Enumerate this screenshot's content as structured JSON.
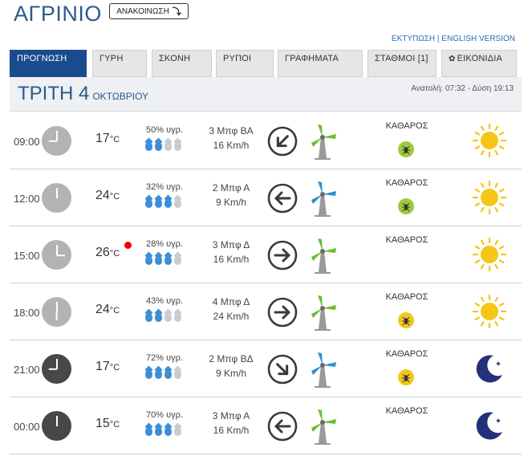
{
  "header": {
    "city": "ΑΓΡΙΝΙΟ",
    "announce_label": "ΑΝΑΚΟΙΝΩΣΗ",
    "announce_arrow": "⤵",
    "print_link": "ΕΚΤΥΠΩΣΗ",
    "sep": "|",
    "english_link": "ENGLISH VERSION"
  },
  "tabs": [
    {
      "label": "ΠΡΟΓΝΩΣΗ",
      "active": true
    },
    {
      "label": "ΓΥΡΗ"
    },
    {
      "label": "ΣΚΟΝΗ"
    },
    {
      "label": "ΡΥΠΟΙ"
    },
    {
      "label": "ΓΡΑΦΗΜΑΤΑ"
    },
    {
      "label": "ΣΤΑΘΜΟΙ [1]"
    },
    {
      "label": "ΕΙΚΟΝΙΔΙΑ",
      "icon": "gear-icon"
    }
  ],
  "day": {
    "name": "ΤΡΙΤΗ 4",
    "month": "ΟΚΤΩΒΡΙΟΥ",
    "sun": "Ανατολή: 07:32 - Δύση 19:13"
  },
  "unit": "°C",
  "rows": [
    {
      "time": "09:00",
      "hour": 9,
      "night": false,
      "temp": "17",
      "hum": "50% υγρ.",
      "drops": 2,
      "beaufort": "3 Μπφ ΒΑ",
      "kmh": "16 Km/h",
      "arrow_deg": 45,
      "turbine_color": "#6cbf2e",
      "turbine_icon": "wind-turbine-icon",
      "cond": "ΚΑΘΑΡΟΣ",
      "mosquito": "green",
      "weather_icon": "sun-icon",
      "reddot": false
    },
    {
      "time": "12:00",
      "hour": 12,
      "night": false,
      "temp": "24",
      "hum": "32% υγρ.",
      "drops": 3,
      "beaufort": "2 Μπφ Α",
      "kmh": "9 Km/h",
      "arrow_deg": 90,
      "turbine_color": "#2f8fd0",
      "turbine_icon": "wind-turbine-icon",
      "cond": "ΚΑΘΑΡΟΣ",
      "mosquito": "green",
      "weather_icon": "sun-icon",
      "reddot": false
    },
    {
      "time": "15:00",
      "hour": 15,
      "night": false,
      "temp": "26",
      "hum": "28% υγρ.",
      "drops": 3,
      "beaufort": "3 Μπφ Δ",
      "kmh": "16 Km/h",
      "arrow_deg": 270,
      "turbine_color": "#6cbf2e",
      "turbine_icon": "wind-turbine-icon",
      "cond": "ΚΑΘΑΡΟΣ",
      "mosquito": null,
      "weather_icon": "sun-icon",
      "reddot": true
    },
    {
      "time": "18:00",
      "hour": 18,
      "night": false,
      "temp": "24",
      "hum": "43% υγρ.",
      "drops": 2,
      "beaufort": "4 Μπφ Δ",
      "kmh": "24 Km/h",
      "arrow_deg": 270,
      "turbine_color": "#6cbf2e",
      "turbine_icon": "wind-turbine-icon",
      "cond": "ΚΑΘΑΡΟΣ",
      "mosquito": "yellow",
      "weather_icon": "sun-icon",
      "reddot": false
    },
    {
      "time": "21:00",
      "hour": 21,
      "night": true,
      "temp": "17",
      "hum": "72% υγρ.",
      "drops": 3,
      "beaufort": "2 Μπφ ΒΔ",
      "kmh": "9 Km/h",
      "arrow_deg": 315,
      "turbine_color": "#2f8fd0",
      "turbine_icon": "wind-turbine-icon",
      "cond": "ΚΑΘΑΡΟΣ",
      "mosquito": "yellow",
      "weather_icon": "moon-icon",
      "reddot": false
    },
    {
      "time": "00:00",
      "hour": 0,
      "night": true,
      "temp": "15",
      "hum": "70% υγρ.",
      "drops": 3,
      "beaufort": "3 Μπφ Α",
      "kmh": "16 Km/h",
      "arrow_deg": 90,
      "turbine_color": "#6cbf2e",
      "turbine_icon": "wind-turbine-icon",
      "cond": "ΚΑΘΑΡΟΣ",
      "mosquito": null,
      "weather_icon": "moon-icon",
      "reddot": false
    }
  ],
  "colors": {
    "brand": "#1b4b8f",
    "title": "#2a5a8c",
    "sun": "#f5c518",
    "moon": "#23307a",
    "drop_on": "#3a8fd6",
    "drop_off": "#c8ccd0"
  }
}
